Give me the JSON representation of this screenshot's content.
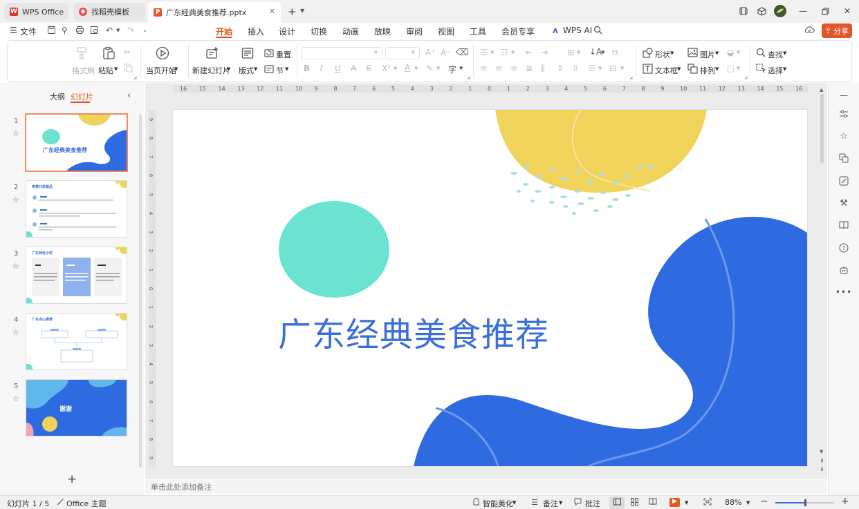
{
  "tabs": [
    {
      "label": "WPS Office"
    },
    {
      "label": "找稻壳模板"
    },
    {
      "label": "广东经典美食推荐.pptx"
    }
  ],
  "menu": {
    "file": "文件",
    "items": [
      "开始",
      "插入",
      "设计",
      "切换",
      "动画",
      "放映",
      "审阅",
      "视图",
      "工具",
      "会员专享"
    ],
    "wps_ai": "WPS AI",
    "share": "分享"
  },
  "ribbon": {
    "format_painter": "格式刷",
    "paste": "粘贴",
    "from_current": "当页开始",
    "new_slide": "新建幻灯片",
    "layout": "版式",
    "reset": "重置",
    "section": "节",
    "shape": "形状",
    "picture": "图片",
    "textbox": "文本框",
    "arrange": "排列",
    "find": "查找",
    "select": "选择"
  },
  "left_panel": {
    "outline_tab": "大纲",
    "slides_tab": "幻灯片",
    "slides": [
      {
        "number": "1",
        "title": "广东经典美食推荐"
      },
      {
        "number": "2",
        "title": "粤菜代表菜品"
      },
      {
        "number": "3",
        "title": "广东特色小吃"
      },
      {
        "number": "4",
        "title": "广东点心推荐"
      },
      {
        "number": "5",
        "title": "谢谢"
      }
    ]
  },
  "ruler": {
    "h_ticks": [
      "16",
      "15",
      "14",
      "13",
      "12",
      "11",
      "10",
      "9",
      "8",
      "7",
      "6",
      "5",
      "4",
      "3",
      "2",
      "1",
      "0",
      "1",
      "2",
      "3",
      "4",
      "5",
      "6",
      "7",
      "8",
      "9",
      "10",
      "11",
      "12",
      "13",
      "14",
      "15",
      "16"
    ],
    "v_ticks": [
      "9",
      "8",
      "7",
      "6",
      "5",
      "4",
      "3",
      "2",
      "1",
      "0",
      "1",
      "2",
      "3",
      "4",
      "5",
      "6",
      "7",
      "8",
      "9"
    ]
  },
  "slide": {
    "title": "广东经典美食推荐"
  },
  "notes_placeholder": "单击此处添加备注",
  "status": {
    "slide_counter": "幻灯片 1 / 5",
    "theme": "Office 主题",
    "beautify": "智能美化",
    "notes": "备注",
    "comments": "批注",
    "zoom": "88%",
    "zoom_fraction": 0.5
  },
  "colors": {
    "accent": "#d8571e",
    "slide_blue": "#2f6be0",
    "slide_yellow": "#f0d35b",
    "slide_teal": "#6ce3d0",
    "title_blue": "#3b6fd8"
  }
}
